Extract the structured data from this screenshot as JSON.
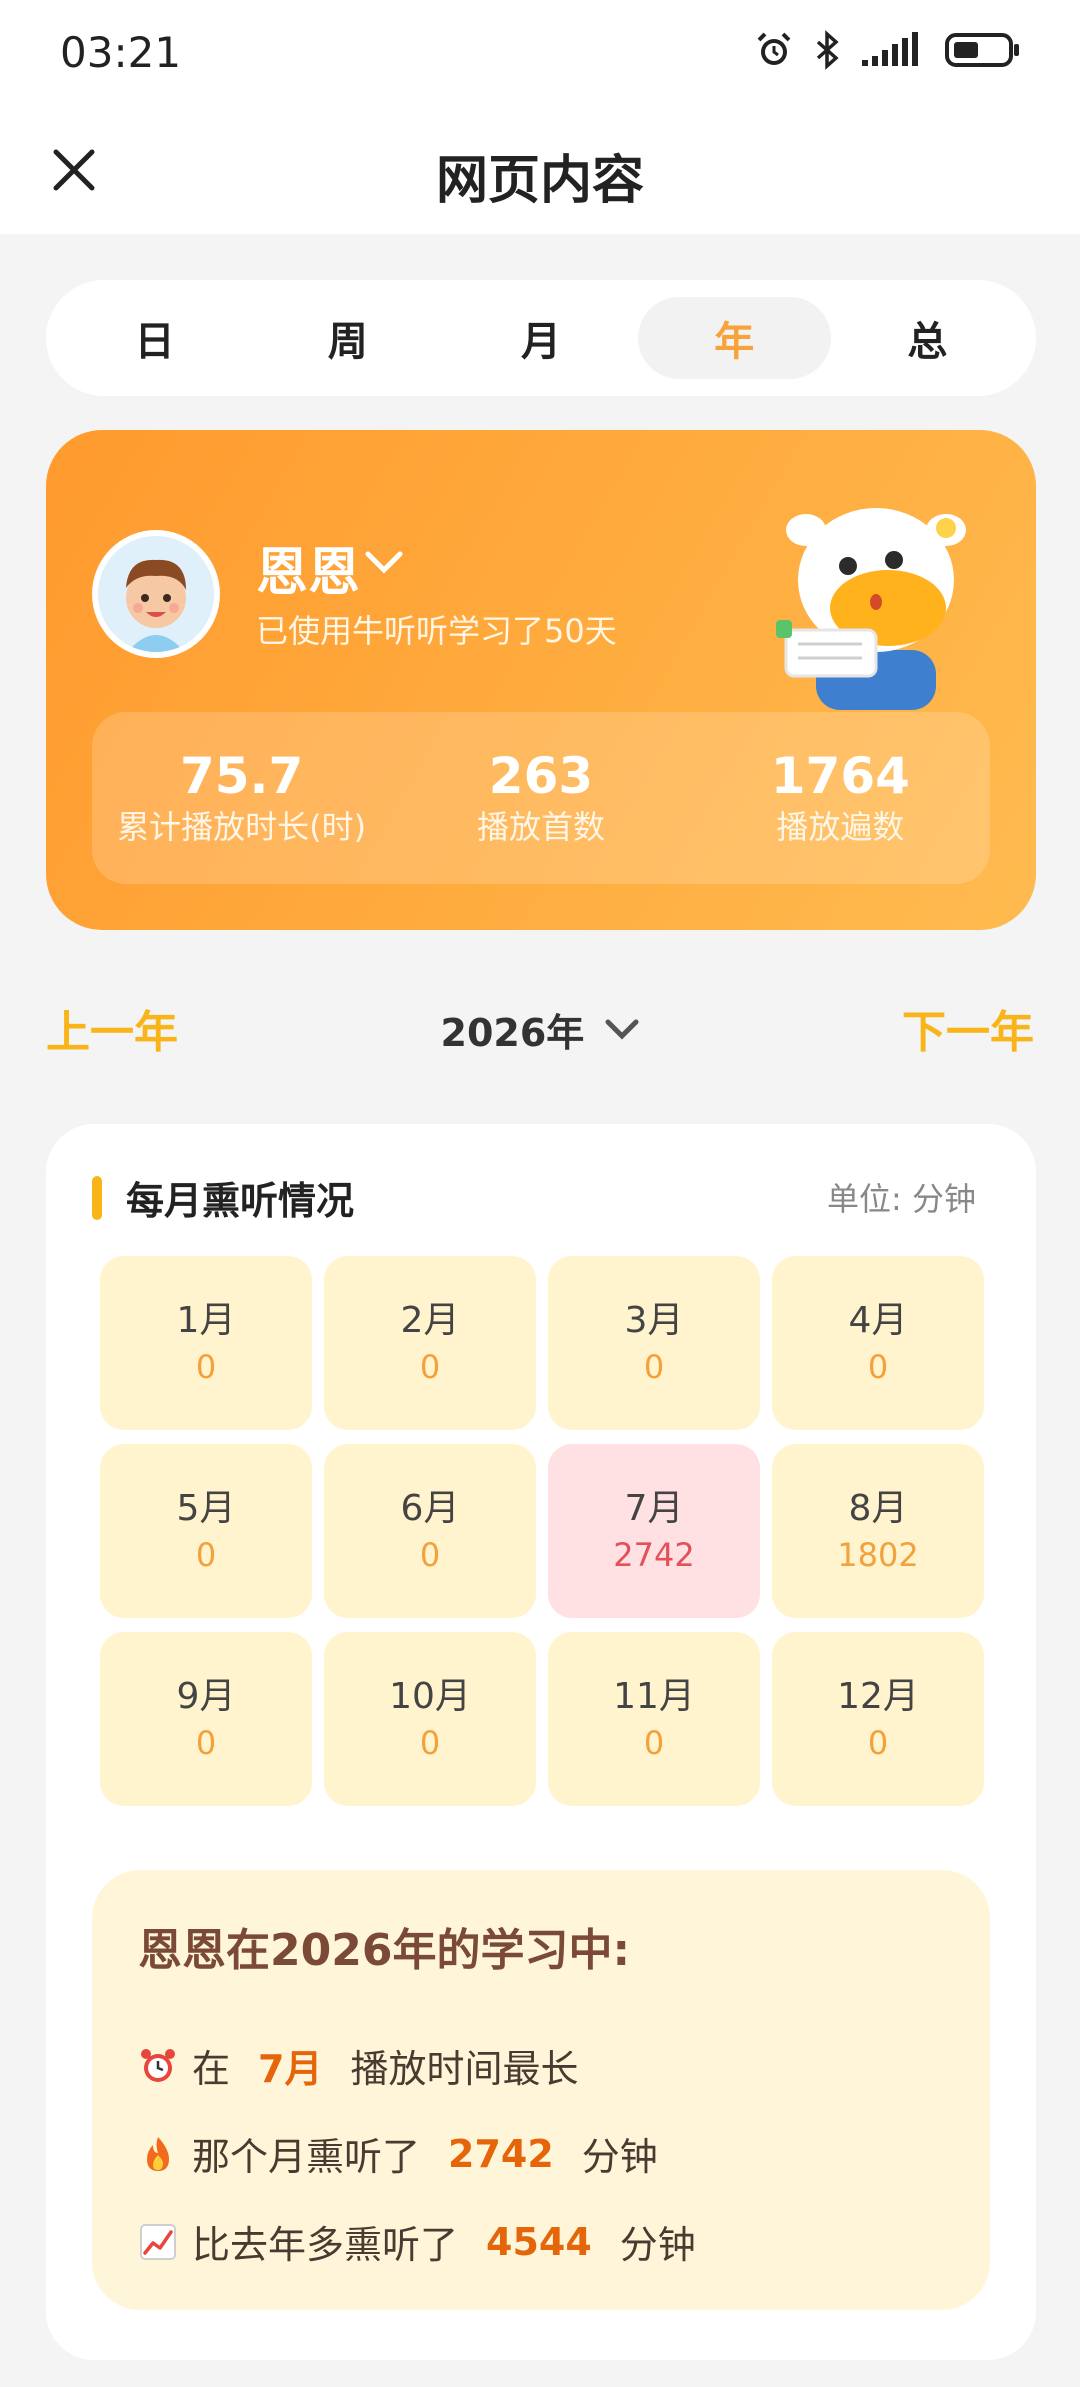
{
  "status_bar": {
    "time": "03:21",
    "icons": [
      "alarm-icon",
      "bluetooth-icon",
      "signal-icon",
      "battery-icon"
    ]
  },
  "header": {
    "title": "网页内容",
    "close_icon": "close-icon"
  },
  "period_tabs": [
    {
      "label": "日",
      "active": false
    },
    {
      "label": "周",
      "active": false
    },
    {
      "label": "月",
      "active": false
    },
    {
      "label": "年",
      "active": true
    },
    {
      "label": "总",
      "active": false
    }
  ],
  "profile": {
    "name": "恩恩",
    "usage_text": "已使用牛听听学习了50天",
    "stats": [
      {
        "value": "75.7",
        "label": "累计播放时长(时)"
      },
      {
        "value": "263",
        "label": "播放首数"
      },
      {
        "value": "1764",
        "label": "播放遍数"
      }
    ]
  },
  "year_nav": {
    "prev_label": "上一年",
    "next_label": "下一年",
    "current_year": "2026年"
  },
  "monthly": {
    "title": "每月熏听情况",
    "unit": "单位: 分钟",
    "months": [
      {
        "name": "1月",
        "value": "0"
      },
      {
        "name": "2月",
        "value": "0"
      },
      {
        "name": "3月",
        "value": "0"
      },
      {
        "name": "4月",
        "value": "0"
      },
      {
        "name": "5月",
        "value": "0"
      },
      {
        "name": "6月",
        "value": "0"
      },
      {
        "name": "7月",
        "value": "2742"
      },
      {
        "name": "8月",
        "value": "1802"
      },
      {
        "name": "9月",
        "value": "0"
      },
      {
        "name": "10月",
        "value": "0"
      },
      {
        "name": "11月",
        "value": "0"
      },
      {
        "name": "12月",
        "value": "0"
      }
    ]
  },
  "summary": {
    "title": "恩恩在2026年的学习中:",
    "line1": {
      "icon": "alarm-clock-emoji",
      "prefix": "在",
      "highlight": "7月",
      "suffix": "播放时间最长"
    },
    "line2": {
      "icon": "fire-emoji",
      "prefix": "那个月熏听了",
      "highlight": "2742",
      "suffix": "分钟"
    },
    "line3": {
      "icon": "chart-increasing-emoji",
      "prefix": "比去年多熏听了",
      "highlight": "4544",
      "suffix": "分钟"
    }
  },
  "colors": {
    "accent": "#f8b418",
    "card_orange": "#ffa135",
    "highlight": "#e5660a",
    "hot_month_bg": "#ffe1e3"
  }
}
